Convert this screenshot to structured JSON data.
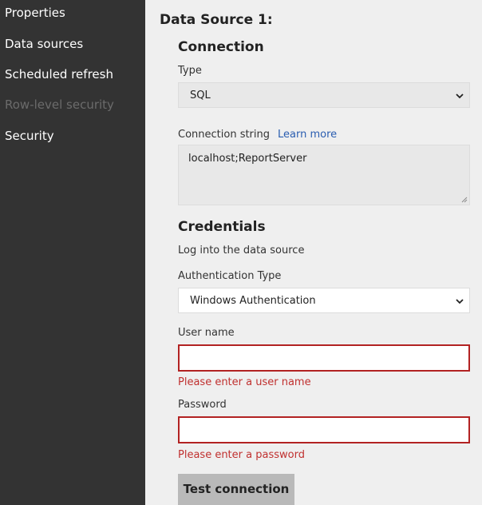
{
  "sidebar": {
    "items": [
      {
        "label": "Properties"
      },
      {
        "label": "Data sources"
      },
      {
        "label": "Scheduled refresh"
      },
      {
        "label": "Row-level security"
      },
      {
        "label": "Security"
      }
    ]
  },
  "main": {
    "title": "Data Source 1:",
    "connection": {
      "heading": "Connection",
      "type_label": "Type",
      "type_value": "SQL",
      "connection_string_label": "Connection string",
      "learn_more": "Learn more",
      "connection_string_value": "localhost;ReportServer"
    },
    "credentials": {
      "heading": "Credentials",
      "subtext": "Log into the data source",
      "auth_type_label": "Authentication Type",
      "auth_type_value": "Windows Authentication",
      "username_label": "User name",
      "username_value": "",
      "username_error": "Please enter a user name",
      "password_label": "Password",
      "password_value": "",
      "password_error": "Please enter a password"
    },
    "test_button": "Test connection"
  },
  "colors": {
    "sidebar_bg": "#333333",
    "main_bg": "#efefef",
    "error": "#c0302f",
    "link": "#2a5db0",
    "button_bg": "#b9b9b9"
  },
  "icons": {
    "select_arrow": "chevron-down-icon",
    "resize_handle": "resize-grip-icon"
  }
}
